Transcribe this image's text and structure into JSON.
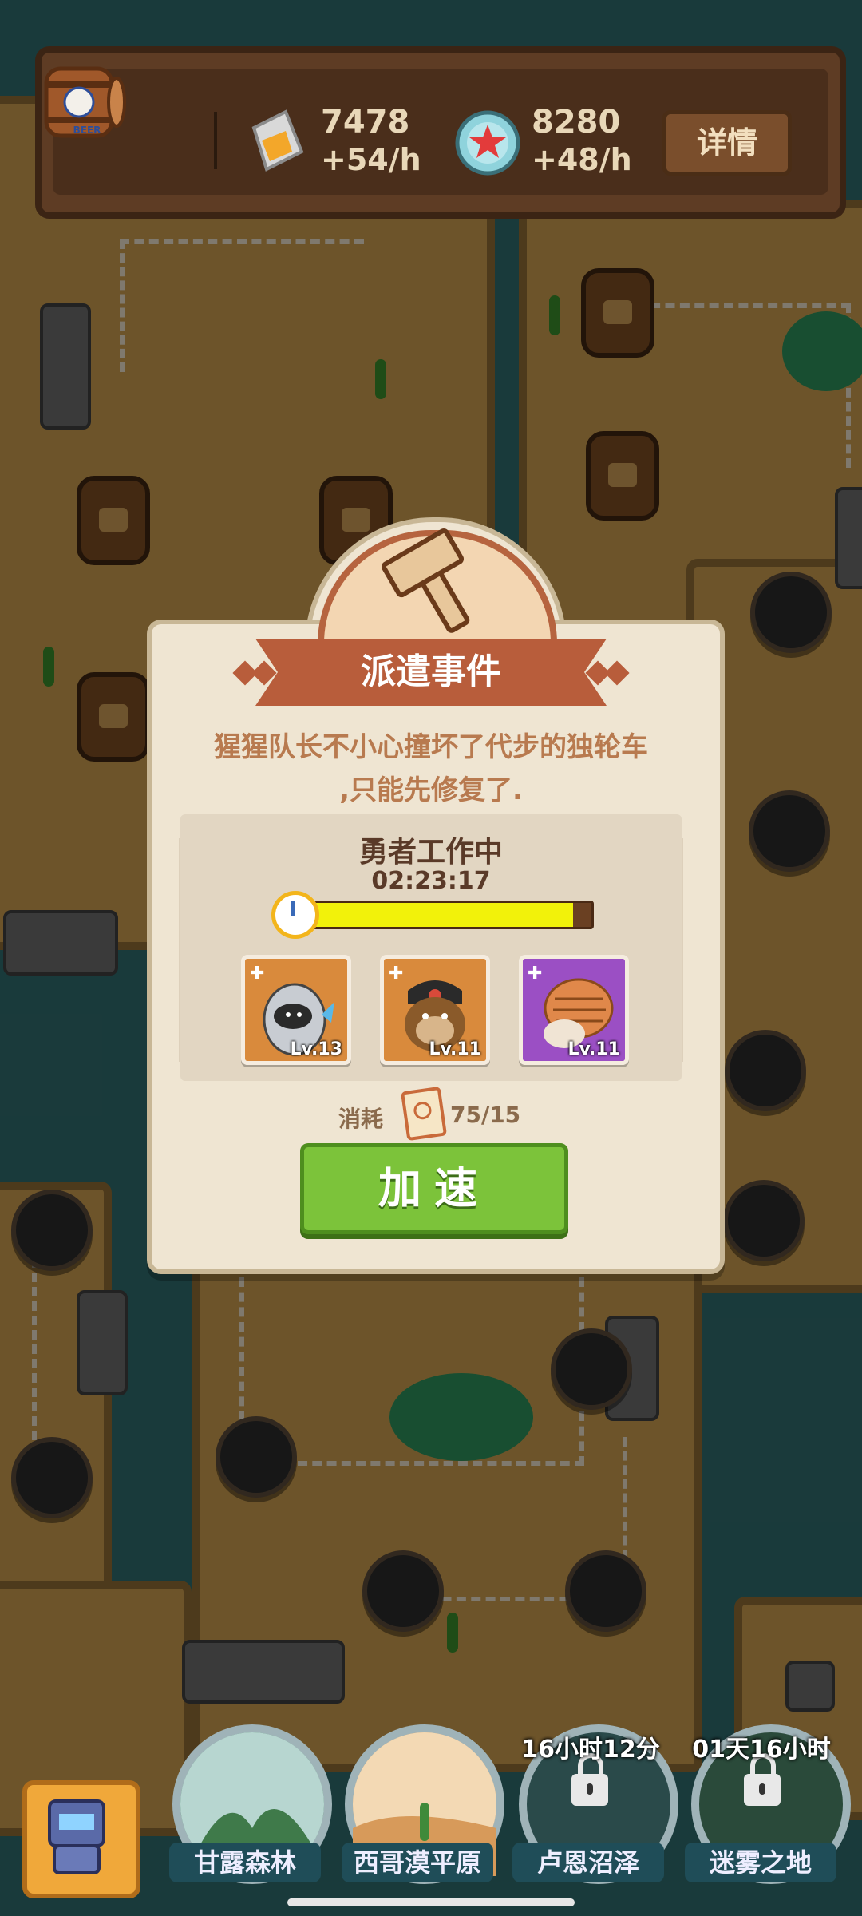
{
  "resources": {
    "res1": {
      "value": "7478",
      "rate": "+54/h",
      "icon": "honey-bag-icon"
    },
    "res2": {
      "value": "8280",
      "rate": "+48/h",
      "icon": "bottle-cap-icon"
    },
    "barrel_label": "BEER",
    "detail_label": "详情"
  },
  "dialog": {
    "title": "派遣事件",
    "description_line1": "猩猩队长不小心撞坏了代步的独轮车",
    "description_line2": ",只能先修复了.",
    "status": "勇者工作中",
    "timer": "02:23:17",
    "progress_fraction": 0.94,
    "heroes": [
      {
        "level": "Lv.13",
        "frame_color": "#d98a3c",
        "icon": "gray-hooded-hero-icon"
      },
      {
        "level": "Lv.11",
        "frame_color": "#d98a3c",
        "icon": "monkey-hero-icon"
      },
      {
        "level": "Lv.11",
        "frame_color": "#9b4fc4",
        "icon": "armadillo-hero-icon"
      }
    ],
    "cost_label": "消耗",
    "cost_value": "75/15",
    "speed_up_label": "加速"
  },
  "regions": [
    {
      "label": "甘露森林",
      "locked": false
    },
    {
      "label": "西哥漠平原",
      "locked": false
    },
    {
      "label": "卢恩沼泽",
      "locked": true,
      "timer": "16小时12分"
    },
    {
      "label": "迷雾之地",
      "locked": true,
      "timer": "01天16小时"
    }
  ]
}
